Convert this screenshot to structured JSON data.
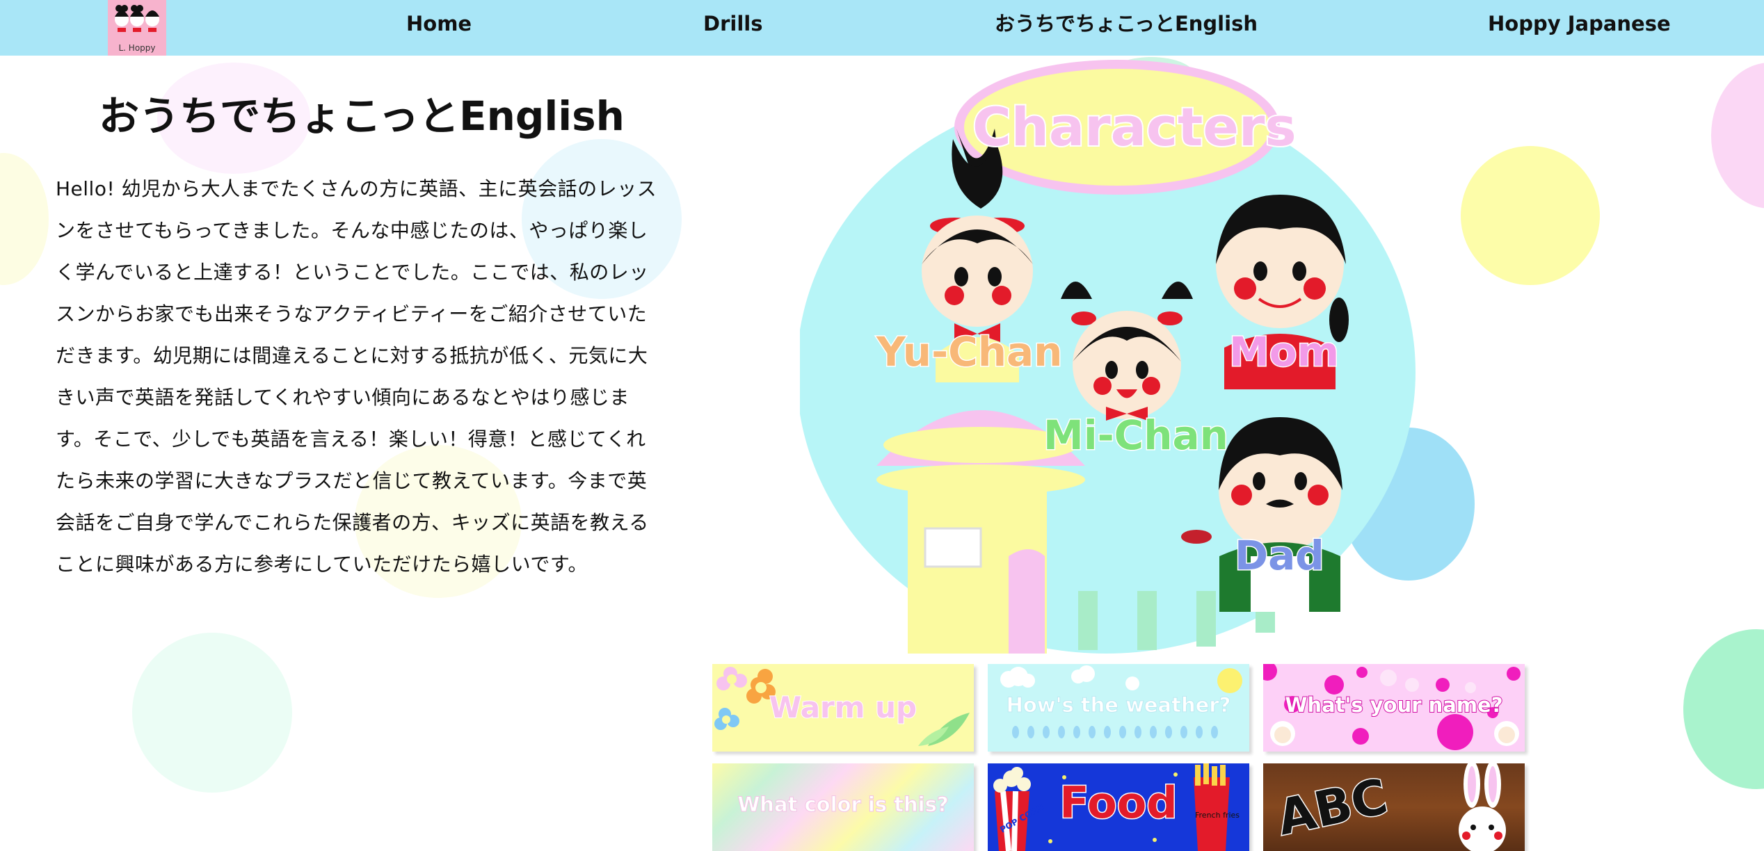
{
  "nav": {
    "logo_text": "L. Hoppy",
    "links": [
      "Home",
      "Drills",
      "おうちでちょこっとEnglish",
      "Hoppy Japanese"
    ]
  },
  "intro": {
    "title": "おうちでちょこっとEnglish",
    "body": "Hello! 幼児から大人までたくさんの方に英語、主に英会話のレッスンをさせてもらってきました。そんな中感じたのは、やっぱり楽しく学んでいると上達する！ということでした。ここでは、私のレッスンからお家でも出来そうなアクティビティーをご紹介させていただきます。幼児期には間違えることに対する抵抗が低く、元気に大きい声で英語を発話してくれやすい傾向にあるなとやはり感じます。そこで、少しでも英語を言える！楽しい！得意！と感じてくれたら未来の学習に大きなプラスだと信じて教えています。今まで英会話をご自身で学んでこれらた保護者の方、キッズに英語を教えることに興味がある方に参考にしていただけたら嬉しいです。"
  },
  "characters": {
    "title": "Characters",
    "names": {
      "yuchan": "Yu-Chan",
      "mom": "Mom",
      "michan": "Mi-Chan",
      "dad": "Dad"
    }
  },
  "cards": [
    {
      "label": "Warm up"
    },
    {
      "label": "How's the weather?"
    },
    {
      "label": "What's your name?"
    },
    {
      "label": "What color is this?"
    },
    {
      "label": "Food",
      "sub1": "POP CORN",
      "sub2": "French fries"
    },
    {
      "label": "ABC"
    }
  ],
  "colors": {
    "nav_bg": "#a9e6f7",
    "logo_bg": "#f7b3cd",
    "char_circle": "#b7f5f7",
    "title_oval": "#fbfaa0",
    "title_oval_border": "#f7c3ef"
  }
}
